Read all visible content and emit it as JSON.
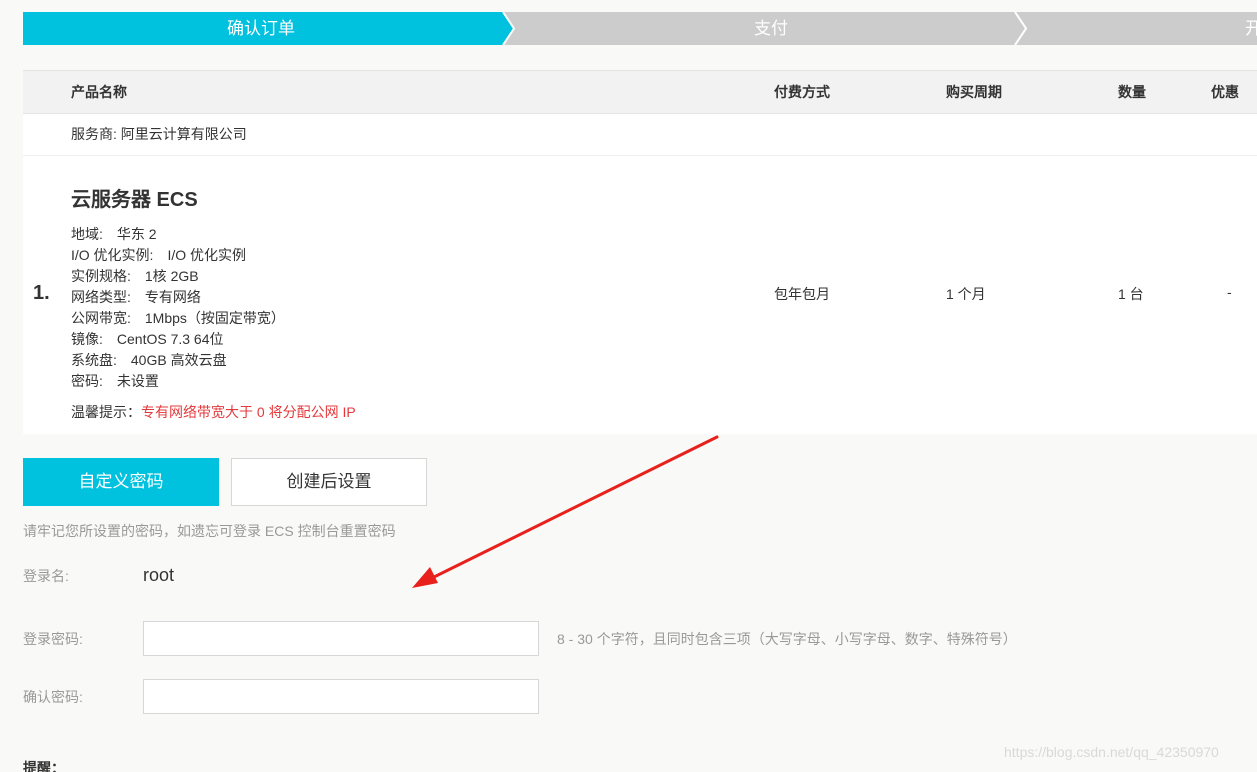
{
  "steps": [
    {
      "label": "确认订单",
      "active": true
    },
    {
      "label": "支付",
      "active": false
    },
    {
      "label": "开",
      "active": false
    }
  ],
  "table": {
    "headers": {
      "product": "产品名称",
      "payment": "付费方式",
      "period": "购买周期",
      "quantity": "数量",
      "discount": "优惠"
    },
    "provider": "服务商: 阿里云计算有限公司",
    "row": {
      "index": "1.",
      "title": "云服务器 ECS",
      "specs": [
        {
          "k": "地域:",
          "v": "华东 2"
        },
        {
          "k": "I/O 优化实例:",
          "v": "I/O 优化实例"
        },
        {
          "k": "实例规格:",
          "v": "1核 2GB"
        },
        {
          "k": "网络类型:",
          "v": "专有网络"
        },
        {
          "k": "公网带宽:",
          "v": "1Mbps（按固定带宽）"
        },
        {
          "k": "镜像:",
          "v": "CentOS 7.3 64位"
        },
        {
          "k": "系统盘:",
          "v": "40GB 高效云盘"
        },
        {
          "k": "密码:",
          "v": "未设置"
        }
      ],
      "tip_label": "温馨提示：",
      "tip_text": "专有网络带宽大于 0 将分配公网 IP",
      "payment": "包年包月",
      "period": "1 个月",
      "quantity": "1 台",
      "discount": "-"
    }
  },
  "password": {
    "custom_button": "自定义密码",
    "later_button": "创建后设置",
    "hint": "请牢记您所设置的密码，如遗忘可登录 ECS 控制台重置密码",
    "login_name_label": "登录名:",
    "login_name": "root",
    "password_label": "登录密码:",
    "password_value": "",
    "password_rule": "8 - 30 个字符，且同时包含三项（大写字母、小写字母、数字、特殊符号）",
    "confirm_label": "确认密码:",
    "confirm_value": "",
    "remind": "提醒："
  },
  "watermark": "https://blog.csdn.net/qq_42350970",
  "colors": {
    "accent": "#00c1de",
    "step_inactive": "#cccccc",
    "warning": "#e4393c",
    "arrow": "#e8211c"
  }
}
